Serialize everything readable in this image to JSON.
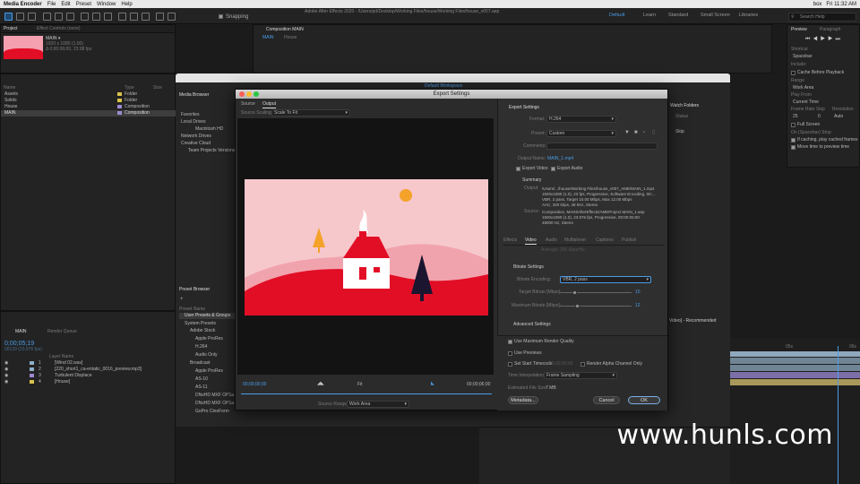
{
  "menubar": {
    "app": "Media Encoder",
    "items": [
      "File",
      "Edit",
      "Preset",
      "Window",
      "Help"
    ],
    "window_title": "Adobe After Effects 2020 - /Users/pd/Desktop/Working Files/house/Working Files/house_v007.aep",
    "right": [
      "box",
      "Fri 11:32 AM"
    ]
  },
  "toolbar": {
    "snapping": "Snapping",
    "workspaces": [
      "Default",
      "Learn",
      "Standard",
      "Small Screen",
      "Libraries"
    ],
    "search_placeholder": "Search Help"
  },
  "project": {
    "tab": "Project",
    "effect_controls": "Effect Controls (none)",
    "comp_name": "MAIN ▾",
    "comp_info1": "1920 x 1080 (1.00)",
    "comp_info2": "Δ 0;00;06;00, 23.98 fps",
    "columns": [
      "Name",
      "Type",
      "Size"
    ],
    "items": [
      {
        "name": "Assets",
        "type": "Folder"
      },
      {
        "name": "Solids",
        "type": "Folder"
      },
      {
        "name": "House",
        "type": "Composition"
      },
      {
        "name": "MAIN",
        "type": "Composition"
      }
    ]
  },
  "comp_viewer": {
    "tab": "Composition MAIN",
    "crumbs": [
      "MAIN",
      "House"
    ]
  },
  "ame": {
    "workspace": "Default Workspace",
    "media_browser": "Media Browser",
    "mb_items": [
      "Favorites",
      "Local Drives",
      "Macintosh HD",
      "Network Drives",
      "Creative Cloud",
      "Team Projects Versions"
    ],
    "preset_browser": "Preset Browser",
    "preset_name": "Preset Name",
    "preset_items": [
      "User Presets & Groups",
      "System Presets",
      "Adobe Stock",
      "Apple ProRes",
      "H.264",
      "Audio Only",
      "Broadcast",
      "Apple ProRes",
      "AS-10",
      "AS-11",
      "DNxHD MXF OP1a",
      "DNxHD MXF OP1a",
      "GoPro CineForm"
    ],
    "watch_folders": "Watch Folders",
    "status": "Status",
    "skip": "Skip",
    "queue_preset": "Video] - Recommended"
  },
  "export": {
    "title": "Export Settings",
    "tabs": [
      "Source",
      "Output"
    ],
    "source_scaling_label": "Source Scaling:",
    "source_scaling": "Scale To Fit",
    "timecode_in": "00;00;00;00",
    "timecode_out": "00;00;06;00",
    "fit": "Fit",
    "source_range_label": "Source Range:",
    "source_range": "Work Area",
    "section": "Export Settings",
    "format_label": "Format:",
    "format": "H.264",
    "preset_label": "Preset:",
    "preset": "Custom",
    "comments_label": "Comments:",
    "output_name_label": "Output Name:",
    "output_name": "MAIN_1.mp4",
    "export_video": "Export Video",
    "export_audio": "Export Audio",
    "summary": "Summary",
    "output_label": "Output:",
    "output_lines": [
      "/Users/.../house/Working Files/house_v007_AME/MAIN_1.mp4",
      "1920x1080 (1.0), 23 fps, Progressive, Software Encoding, 00:...",
      "VBR, 2 pass, Target 10.00 Mbps, Max 12.00 Mbps",
      "AAC, 320 kbps, 48 kHz, Stereo"
    ],
    "source_label": "Source:",
    "source_lines": [
      "Composition, MAIN/AfterEffects/AMEProject MAIN_1.aep",
      "1920x1080 (1.0), 23.976 fps, Progressive, 00:00:06:00",
      "48000 Hz, Stereo"
    ],
    "settings_tabs": [
      "Effects",
      "Video",
      "Audio",
      "Multiplexer",
      "Captions",
      "Publish"
    ],
    "average_label": "Average:",
    "average": "256 kbps/Hz",
    "bitrate_settings": "Bitrate Settings",
    "bitrate_encoding_label": "Bitrate Encoding:",
    "bitrate_encoding": "VBR, 2 pass",
    "target_bitrate_label": "Target Bitrate [Mbps]:",
    "target_bitrate": "10",
    "max_bitrate_label": "Maximum Bitrate [Mbps]:",
    "max_bitrate": "12",
    "advanced": "Advanced Settings",
    "use_max_render": "Use Maximum Render Quality",
    "use_previews": "Use Previews",
    "set_start_tc": "Set Start Timecode",
    "start_tc": "00;00;00;00",
    "render_alpha": "Render Alpha Channel Only",
    "time_interp_label": "Time Interpolation:",
    "time_interp": "Frame Sampling",
    "file_size_label": "Estimated File Size:",
    "file_size": "7 MB",
    "metadata": "Metadata...",
    "cancel": "Cancel",
    "ok": "OK"
  },
  "timeline": {
    "comp": "MAIN",
    "render_queue": "Render Queue",
    "time": "0;00;05;19",
    "time_sub": "00139 (23.976 fps)",
    "layer_header": "Layer Name",
    "layers": [
      {
        "num": "1",
        "name": "[Wind 02.wav]"
      },
      {
        "num": "2",
        "name": "[220_short1_ca-entatic_0016_preview.mp3]"
      },
      {
        "num": "3",
        "name": "Turbulent Displace"
      },
      {
        "num": "4",
        "name": "[House]"
      }
    ],
    "ruler": [
      "05s",
      "06s"
    ]
  },
  "right_panel": {
    "tabs": [
      "Preview",
      "Paragraph"
    ],
    "shortcut_label": "Shortcut",
    "shortcut": "Spacebar",
    "include_label": "Include:",
    "cache": "Cache Before Playback",
    "range_label": "Range",
    "range": "Work Area",
    "play_from_label": "Play From",
    "play_from": "Current Time",
    "frame_rate_label": "Frame Rate",
    "skip_label": "Skip",
    "resolution_label": "Resolution",
    "frame_rate": "25",
    "skip": "0",
    "resolution": "Auto",
    "full_screen": "Full Screen",
    "on_stop": "On (Spacebar) Stop:",
    "if_caching": "If caching, play cached frames",
    "move_time": "Move time to preview time"
  },
  "watermark": "www.hunls.com",
  "colors": {
    "accent": "#4a9ce8",
    "preview_sky": "#f6c8cc",
    "preview_red": "#e20e26",
    "sun": "#f4a22a"
  }
}
